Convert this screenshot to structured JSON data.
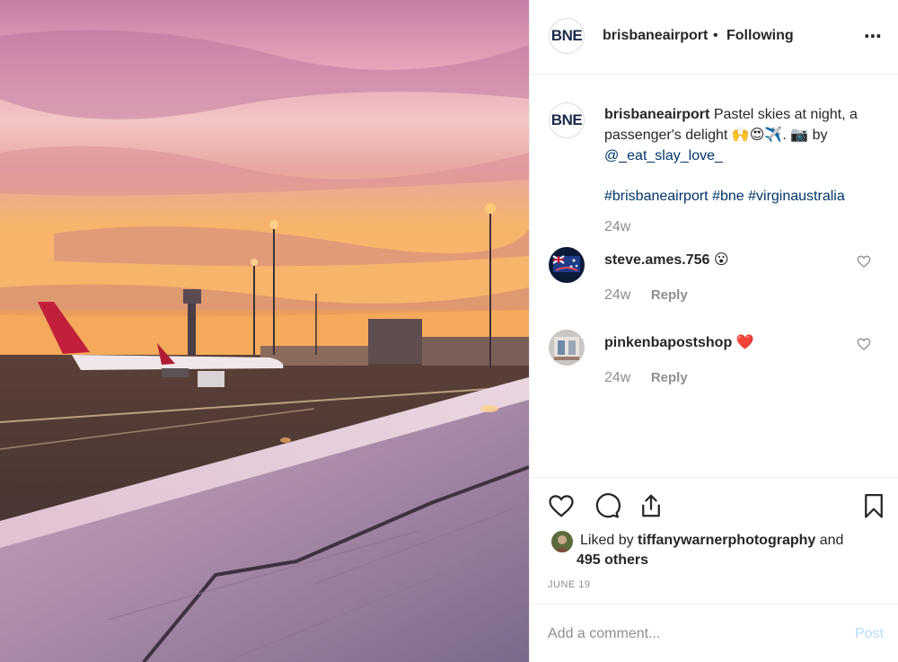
{
  "photo": {
    "alt_subject": "airport-sunset-wing"
  },
  "header": {
    "avatar_text": "BNE",
    "username": "brisbaneairport",
    "separator": "•",
    "follow_status": "Following",
    "more_icon": "⋯"
  },
  "caption": {
    "avatar_text": "BNE",
    "username": "brisbaneairport",
    "text": "Pastel skies at night, a passenger's delight 🙌😍✈️. 📷 by ",
    "mention": "@_eat_slay_love_",
    "hashtags": "#brisbaneairport #bne #virginaustralia",
    "time": "24w"
  },
  "comments": [
    {
      "username": "steve.ames.756",
      "text": "😮",
      "time": "24w",
      "reply_label": "Reply"
    },
    {
      "username": "pinkenbapostshop",
      "text": "❤️",
      "time": "24w",
      "reply_label": "Reply"
    }
  ],
  "actions": {
    "icons": [
      "heart-icon",
      "comment-icon",
      "share-icon",
      "bookmark-icon"
    ]
  },
  "likes": {
    "prefix": "Liked by ",
    "user": "tiffanywarnerphotography",
    "and": " and",
    "others": "495 others"
  },
  "date": "JUNE 19",
  "add_comment": {
    "placeholder": "Add a comment...",
    "post_label": "Post"
  },
  "colors": {
    "link": "#003569",
    "muted": "#8e8e8e",
    "post_disabled": "#b3dbff",
    "text": "#262626"
  }
}
